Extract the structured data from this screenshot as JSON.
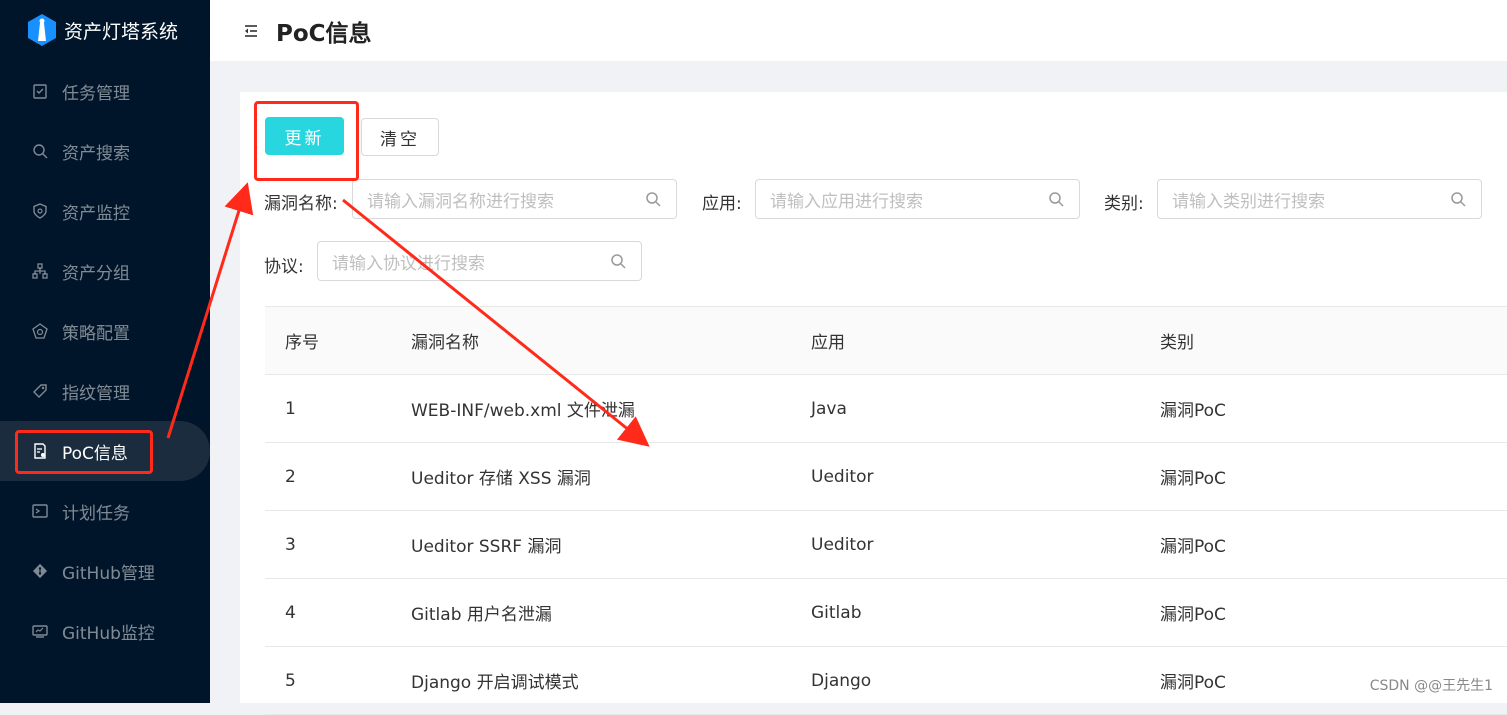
{
  "app": {
    "title": "资产灯塔系统"
  },
  "sidebar": {
    "items": [
      {
        "label": "任务管理",
        "icon": "task-icon"
      },
      {
        "label": "资产搜索",
        "icon": "search-icon"
      },
      {
        "label": "资产监控",
        "icon": "shield-icon"
      },
      {
        "label": "资产分组",
        "icon": "group-icon"
      },
      {
        "label": "策略配置",
        "icon": "policy-icon"
      },
      {
        "label": "指纹管理",
        "icon": "tag-icon"
      },
      {
        "label": "PoC信息",
        "icon": "doc-icon",
        "active": true
      },
      {
        "label": "计划任务",
        "icon": "terminal-icon"
      },
      {
        "label": "GitHub管理",
        "icon": "git-icon"
      },
      {
        "label": "GitHub监控",
        "icon": "monitor-icon"
      }
    ]
  },
  "header": {
    "title": "PoC信息"
  },
  "toolbar": {
    "update_label": "更新",
    "clear_label": "清空"
  },
  "filters": {
    "vuln_name_label": "漏洞名称:",
    "vuln_name_placeholder": "请输入漏洞名称进行搜索",
    "app_label": "应用:",
    "app_placeholder": "请输入应用进行搜索",
    "category_label": "类别:",
    "category_placeholder": "请输入类别进行搜索",
    "protocol_label": "协议:",
    "protocol_placeholder": "请输入协议进行搜索"
  },
  "table": {
    "headers": [
      "序号",
      "漏洞名称",
      "应用",
      "类别"
    ],
    "rows": [
      [
        "1",
        "WEB-INF/web.xml 文件泄漏",
        "Java",
        "漏洞PoC"
      ],
      [
        "2",
        "Ueditor 存储 XSS 漏洞",
        "Ueditor",
        "漏洞PoC"
      ],
      [
        "3",
        "Ueditor SSRF 漏洞",
        "Ueditor",
        "漏洞PoC"
      ],
      [
        "4",
        "Gitlab 用户名泄漏",
        "Gitlab",
        "漏洞PoC"
      ],
      [
        "5",
        "Django 开启调试模式",
        "Django",
        "漏洞PoC"
      ]
    ]
  },
  "watermark": "CSDN @@王先生1",
  "colors": {
    "sidebar_bg": "#001529",
    "primary": "#28d6df",
    "annotation": "#ff2a1a"
  }
}
